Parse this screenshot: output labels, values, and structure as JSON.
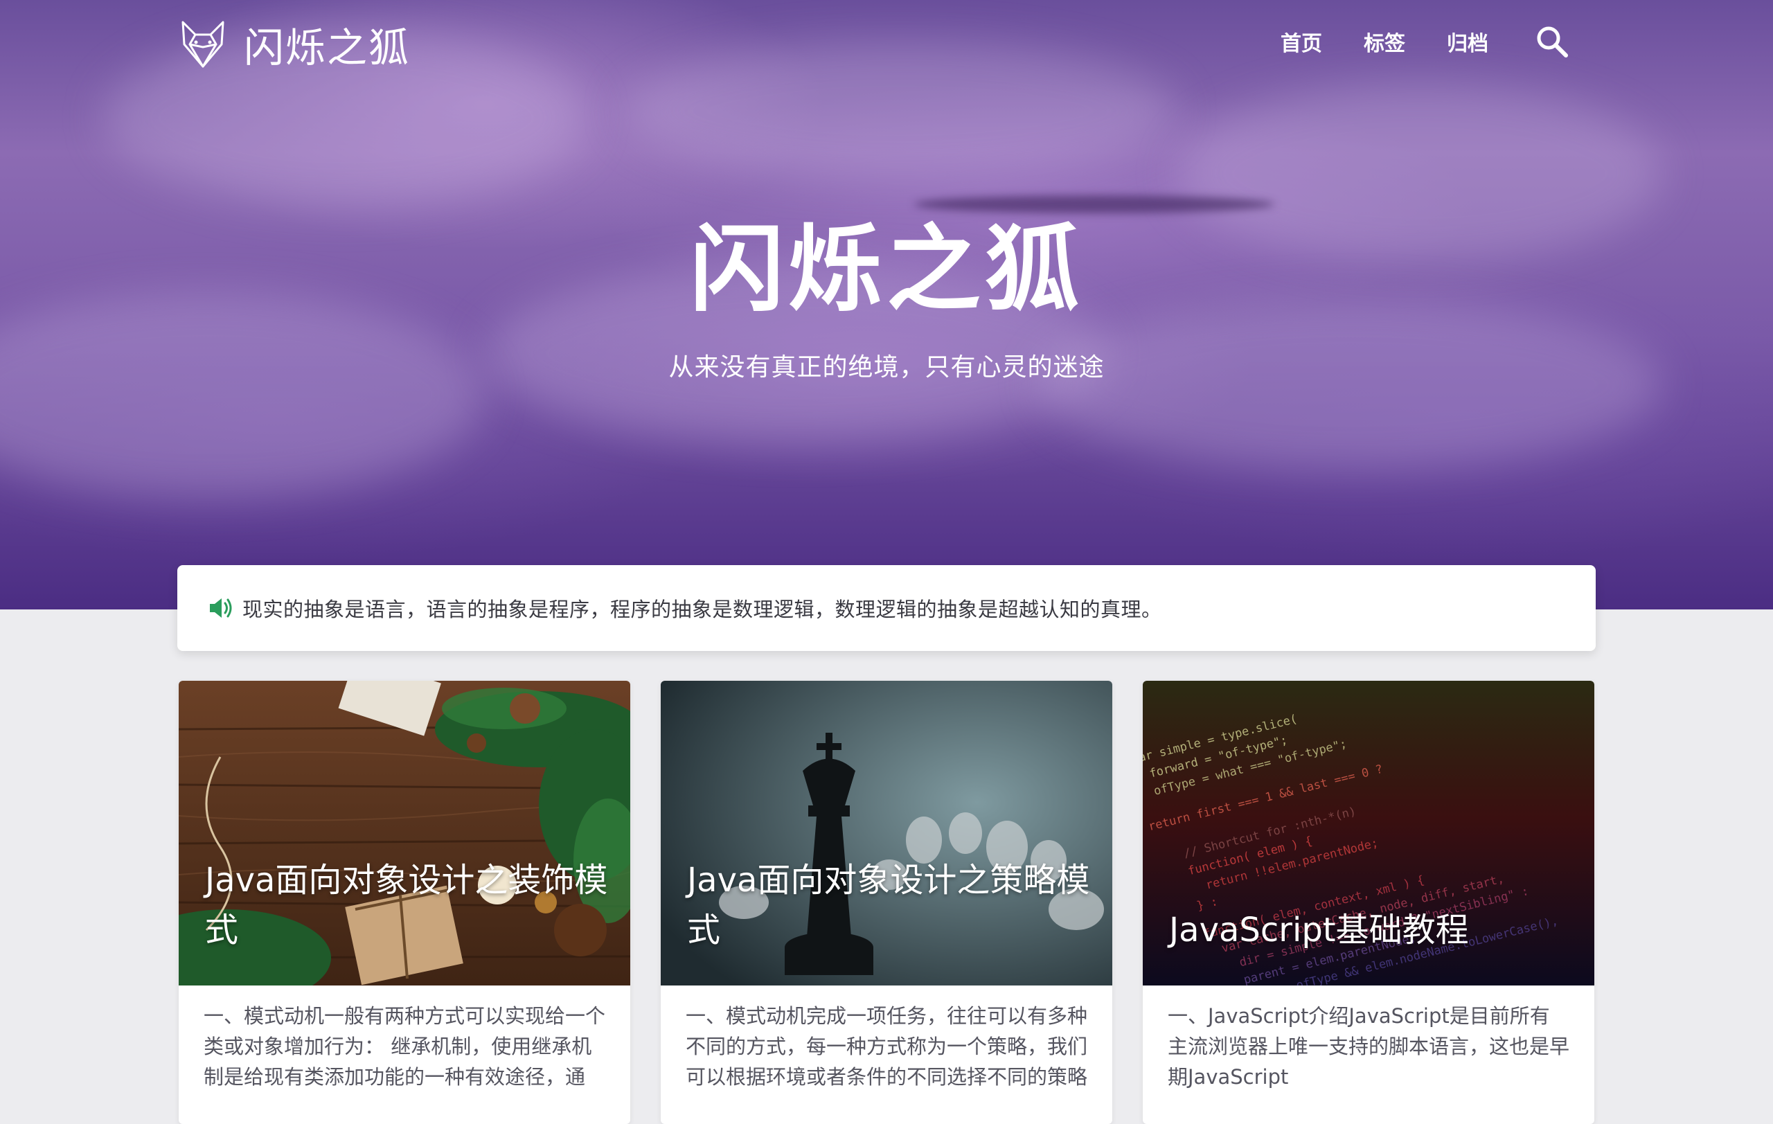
{
  "site": {
    "brand": "闪烁之狐",
    "title": "闪烁之狐",
    "subtitle": "从来没有真正的绝境，只有心灵的迷途"
  },
  "nav": {
    "items": [
      {
        "label": "首页"
      },
      {
        "label": "标签"
      },
      {
        "label": "归档"
      }
    ],
    "search_icon": "search-icon"
  },
  "notice": {
    "icon": "speaker-icon",
    "text": "现实的抽象是语言，语言的抽象是程序，程序的抽象是数理逻辑，数理逻辑的抽象是超越认知的真理。"
  },
  "posts": [
    {
      "title": "Java面向对象设计之装饰模式",
      "summary": "一、模式动机一般有两种方式可以实现给一个类或对象增加行为： 继承机制，使用继承机制是给现有类添加功能的一种有效途径，通"
    },
    {
      "title": "Java面向对象设计之策略模式",
      "summary": "一、模式动机完成一项任务，往往可以有多种不同的方式，每一种方式称为一个策略，我们可以根据环境或者条件的不同选择不同的策略"
    },
    {
      "title": "JavaScript基础教程",
      "summary": "一、JavaScript介绍JavaScript是目前所有主流浏览器上唯一支持的脚本语言，这也是早期JavaScript"
    }
  ],
  "colors": {
    "hero_top": "#6a4f9c",
    "hero_bottom": "#4b2d83",
    "page_bg": "#ececef",
    "speaker_green": "#2a9d5c"
  }
}
